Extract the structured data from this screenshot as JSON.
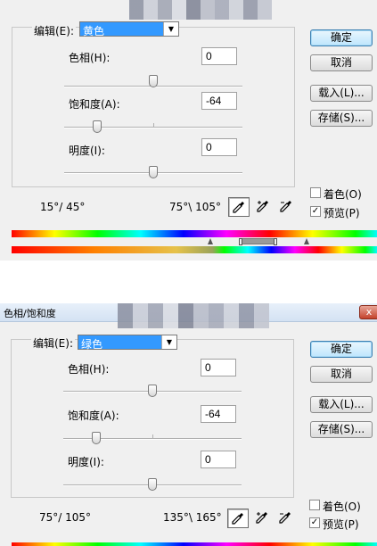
{
  "dialogs": [
    {
      "title": "",
      "edit_label": "编辑(E):",
      "edit_value": "黄色",
      "hue_label": "色相(H):",
      "hue_value": "0",
      "saturation_label": "饱和度(A):",
      "saturation_value": "-64",
      "lightness_label": "明度(I):",
      "lightness_value": "0",
      "ok_label": "确定",
      "cancel_label": "取消",
      "load_label": "载入(L)...",
      "save_label": "存储(S)...",
      "colorize_label": "着色(O)",
      "colorize_checked": false,
      "preview_label": "预览(P)",
      "preview_checked": true,
      "range_left": "15°/ 45°",
      "range_right": "75°\\ 105°",
      "slider_levels": {
        "hue": 0,
        "saturation": -64,
        "lightness": 0
      },
      "icons": [
        "eyedropper-icon",
        "eyedropper-plus-icon",
        "eyedropper-minus-icon"
      ]
    },
    {
      "title": "色相/饱和度",
      "edit_label": "编辑(E):",
      "edit_value": "绿色",
      "hue_label": "色相(H):",
      "hue_value": "0",
      "saturation_label": "饱和度(A):",
      "saturation_value": "-64",
      "lightness_label": "明度(I):",
      "lightness_value": "0",
      "ok_label": "确定",
      "cancel_label": "取消",
      "load_label": "载入(L)...",
      "save_label": "存储(S)...",
      "colorize_label": "着色(O)",
      "colorize_checked": false,
      "preview_label": "预览(P)",
      "preview_checked": true,
      "range_left": "75°/ 105°",
      "range_right": "135°\\ 165°",
      "slider_levels": {
        "hue": 0,
        "saturation": -64,
        "lightness": 0
      },
      "icons": [
        "eyedropper-icon",
        "eyedropper-plus-icon",
        "eyedropper-minus-icon"
      ],
      "close_label": "x"
    }
  ],
  "colors": {
    "dialog_bg": "#f0f0f0",
    "select_highlight": "#3399ff",
    "title_gradient_top": "#e8f0fa",
    "close_red": "#c4422c"
  }
}
